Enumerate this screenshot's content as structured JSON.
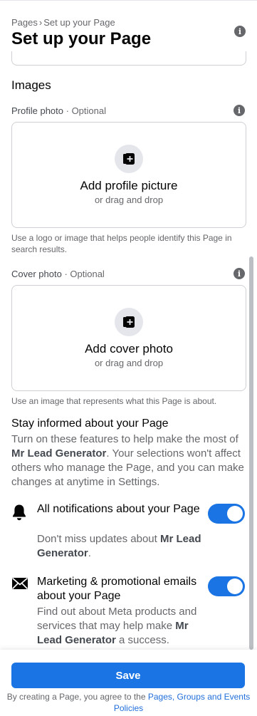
{
  "header": {
    "breadcrumb_root": "Pages",
    "breadcrumb_sep": "›",
    "breadcrumb_current": "Set up your Page",
    "title": "Set up your Page",
    "info_icon": "info-icon"
  },
  "images_section": {
    "heading": "Images",
    "profile": {
      "label": "Profile photo",
      "optional": "· Optional",
      "add_label": "Add profile picture",
      "drag_label": "or drag and drop",
      "help": "Use a logo or image that helps people identify this Page in search results.",
      "icon": "add-photo-icon"
    },
    "cover": {
      "label": "Cover photo",
      "optional": "· Optional",
      "add_label": "Add cover photo",
      "drag_label": "or drag and drop",
      "help": "Use an image that represents what this Page is about.",
      "icon": "add-photo-icon"
    }
  },
  "stay_informed": {
    "title": "Stay informed about your Page",
    "desc_before": "Turn on these features to help make the most of ",
    "page_name": "Mr Lead Generator",
    "desc_after": ". Your selections won't affect others who manage the Page, and you can make changes at anytime in Settings.",
    "notifications": {
      "icon": "bell-icon",
      "title": "All notifications about your Page",
      "desc_before": "Don't miss updates about ",
      "page_name": "Mr Lead Generator",
      "desc_after": ".",
      "enabled": true
    },
    "marketing": {
      "icon": "envelope-icon",
      "title": "Marketing & promotional emails about your Page",
      "desc_before": "Find out about Meta products and services that may help make ",
      "page_name": "Mr Lead Generator",
      "desc_after": " a success.",
      "enabled": true
    }
  },
  "footer": {
    "save_label": "Save",
    "terms_before": "By creating a Page, you agree to the ",
    "terms_link": "Pages, Groups and Events Policies"
  },
  "colors": {
    "accent": "#1b74e4",
    "link": "#216fdb",
    "secondary_text": "#65676b"
  }
}
